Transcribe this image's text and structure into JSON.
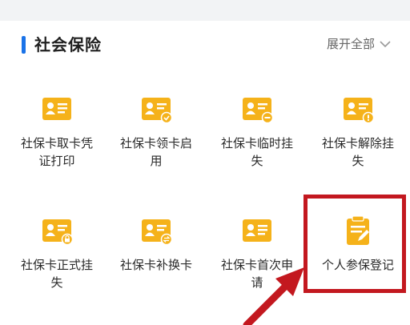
{
  "section": {
    "title": "社会保险",
    "expand_label": "展开全部"
  },
  "colors": {
    "accent": "#1a73e8",
    "icon_yellow": "#f5b21a",
    "highlight_red": "#c3181f"
  },
  "tiles": [
    {
      "label": "社保卡取卡凭证打印",
      "icon": "id-card-icon"
    },
    {
      "label": "社保卡领卡启用",
      "icon": "id-card-check-icon"
    },
    {
      "label": "社保卡临时挂失",
      "icon": "id-card-minus-icon"
    },
    {
      "label": "社保卡解除挂失",
      "icon": "id-card-alert-icon"
    },
    {
      "label": "社保卡正式挂失",
      "icon": "id-card-lock-icon"
    },
    {
      "label": "社保卡补换卡",
      "icon": "id-card-swap-icon"
    },
    {
      "label": "社保卡首次申请",
      "icon": "id-card-icon"
    },
    {
      "label": "个人参保登记",
      "icon": "clipboard-edit-icon"
    }
  ]
}
